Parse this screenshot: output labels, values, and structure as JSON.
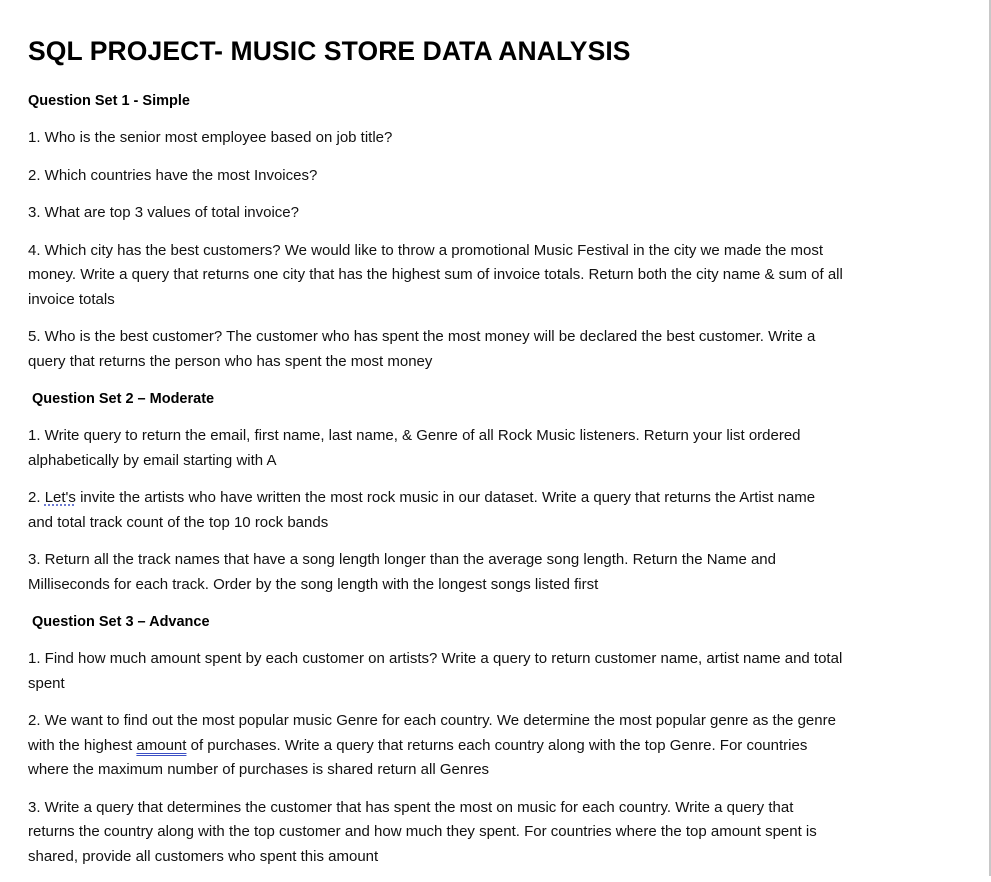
{
  "title": "SQL PROJECT- MUSIC STORE DATA ANALYSIS",
  "set1": {
    "heading": "Question Set 1 - Simple",
    "q1": [
      "1. Who is the senior most employee based on job title?"
    ],
    "q2": [
      "2. Which countries have the most Invoices?"
    ],
    "q3": [
      "3. What are top 3 values of total invoice?"
    ],
    "q4": [
      "4. Which city has the best customers? We would like to throw a promotional Music Festival in the city we made the most",
      "money. Write a query that returns one city that has the highest sum of invoice totals. Return both the city name & sum of all",
      "invoice totals"
    ],
    "q5": [
      "5. Who is the best customer? The customer who has spent the most money will be declared the best customer. Write a",
      "query that returns the person who has spent the most money"
    ]
  },
  "set2": {
    "heading": "Question Set 2 – Moderate",
    "q1": [
      "1. Write query to return the email, first name, last name, & Genre of all Rock Music listeners. Return your list ordered",
      "alphabetically by email starting with A"
    ],
    "q2": {
      "prefix": "2. ",
      "flagged": "Let's",
      "rest": " invite the artists who have written the most rock music in our dataset. Write a query that returns the Artist name",
      "line2": "and total track count of the top 10 rock bands"
    },
    "q3": [
      "3. Return all the track names that have a song length longer than the average song length. Return the Name and",
      "Milliseconds for each track. Order by the song length with the longest songs listed first"
    ]
  },
  "set3": {
    "heading": "Question Set 3 – Advance",
    "q1": [
      "1. Find how much amount spent by each customer on artists? Write a query to return customer name, artist name and total",
      "spent"
    ],
    "q2": {
      "line1": "2. We want to find out the most popular music Genre for each country. We determine the most popular genre as the genre",
      "line2_prefix": "with the highest ",
      "flagged": "amount",
      "line2_rest": " of purchases. Write a query that returns each country along with the top Genre. For countries",
      "line3": "where the maximum number of purchases is shared return all Genres"
    },
    "q3": [
      "3. Write a query that determines the customer that has spent the most on music for each country. Write a query that",
      "returns the country along with the top customer and how much they spent. For countries where the top amount spent is",
      "shared, provide all customers who spent this amount"
    ]
  },
  "colors": {
    "proofing_underline": "#3b4fc4",
    "page_border": "#c8c8c8"
  }
}
